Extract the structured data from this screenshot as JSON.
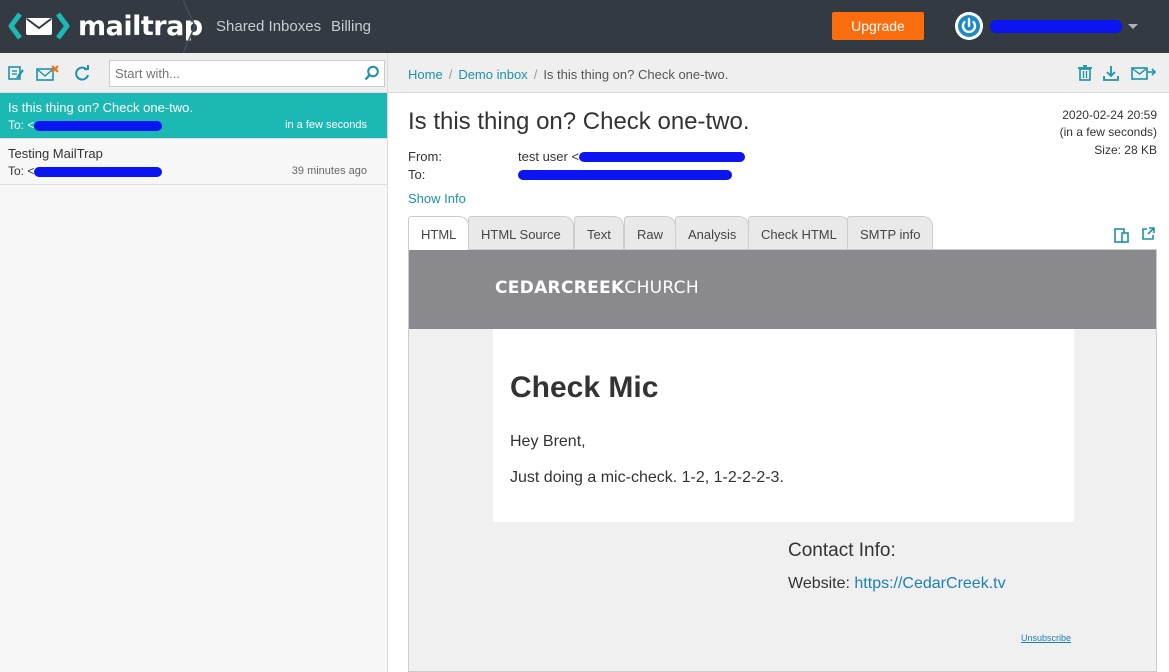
{
  "app": {
    "logo_text": "mailtrap",
    "nav": [
      "Shared Inboxes",
      "Billing"
    ],
    "upgrade_label": "Upgrade"
  },
  "left": {
    "search_placeholder": "Start with...",
    "messages": [
      {
        "subject": "Is this thing on? Check one-two.",
        "to_prefix": "To: <",
        "time": "in a few seconds"
      },
      {
        "subject": "Testing MailTrap",
        "to_prefix": "To: <",
        "time": "39 minutes ago"
      }
    ]
  },
  "breadcrumb": {
    "home": "Home",
    "inbox": "Demo inbox",
    "current": "Is this thing on? Check one-two."
  },
  "message": {
    "subject": "Is this thing on? Check one-two.",
    "from_label": "From:",
    "from_value": "test user <",
    "to_label": "To:",
    "date": "2020-02-24 20:59",
    "relative": "(in a few seconds)",
    "size": "Size: 28 KB",
    "show_info": "Show Info"
  },
  "tabs": [
    "HTML",
    "HTML Source",
    "Text",
    "Raw",
    "Analysis",
    "Check HTML",
    "SMTP info"
  ],
  "email": {
    "brand_bold": "CEDARCREEK",
    "brand_light": "CHURCH",
    "heading": "Check Mic",
    "greeting": "Hey Brent,",
    "body": "Just doing a mic-check. 1-2, 1-2-2-2-3.",
    "contact_heading": "Contact Info:",
    "website_label": "Website: ",
    "website_link": "https://CedarCreek.tv",
    "unsubscribe": "Unsubscribe"
  },
  "colors": {
    "topbar": "#333a42",
    "accent": "#1cb8b3",
    "upgrade": "#f96d0f",
    "link": "#1b93a8",
    "email_header": "#8a898e"
  }
}
